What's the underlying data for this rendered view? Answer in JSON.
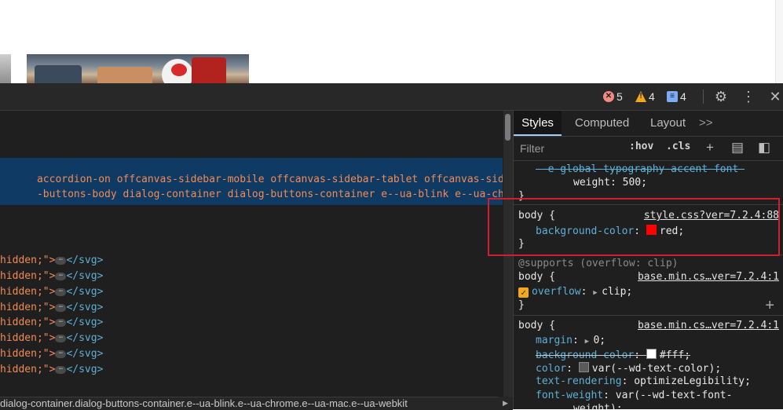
{
  "toolbar": {
    "errors": "5",
    "warnings": "4",
    "messages": "4"
  },
  "elements": {
    "selected_line1": "accordion-on offcanvas-sidebar-mobile offcanvas-sidebar-tablet offcanvas-side",
    "selected_line2": "-buttons-body dialog-container dialog-buttons-container e--ua-blink e--ua-chr",
    "svg_lines": [
      {
        "attr": "hidden;\">",
        "close": "</svg>"
      },
      {
        "attr": "hidden;\">",
        "close": "</svg>"
      },
      {
        "attr": "hidden;\">",
        "close": "</svg>"
      },
      {
        "attr": "hidden;\">",
        "close": "</svg>"
      },
      {
        "attr": "hidden;\">",
        "close": "</svg>"
      },
      {
        "attr": "hidden;\">",
        "close": "</svg>"
      },
      {
        "attr": "hidden;\">",
        "close": "</svg>"
      },
      {
        "attr": "hidden;\">",
        "close": "</svg>"
      }
    ],
    "ellipsis": "⋯",
    "breadcrumb": "dialog-container.dialog-buttons-container.e--ua-blink.e--ua-chrome.e--ua-mac.e--ua-webkit"
  },
  "styles": {
    "tabs": {
      "styles": "Styles",
      "computed": "Computed",
      "layout": "Layout",
      "more": ">>"
    },
    "filter_placeholder": "Filter",
    "hov": ":hov",
    "cls": ".cls",
    "rule0": {
      "prop_line": "--e-global-typography-accent-font-",
      "prop_line2": "weight: 500;",
      "close": "}"
    },
    "rule1": {
      "selector": "body {",
      "source": "style.css?ver=7.2.4:88",
      "prop": "background-color",
      "value": "red;",
      "swatch": "#ff0000",
      "close": "}"
    },
    "rule2": {
      "at": "@supports (overflow: clip)",
      "selector": "body {",
      "source": "base.min.cs…ver=7.2.4:1",
      "prop": "overflow",
      "value": "clip;",
      "close": "}"
    },
    "rule3": {
      "selector": "body {",
      "source": "base.min.cs…ver=7.2.4:1",
      "props": [
        {
          "name": "margin",
          "value": "0;",
          "arrow": true
        },
        {
          "name": "background-color",
          "value": "#fff;",
          "swatch": "#ffffff",
          "strike": true
        },
        {
          "name": "color",
          "value": "var(--wd-text-color);",
          "swatch": "#5a5a5a"
        },
        {
          "name": "text-rendering",
          "value": "optimizeLegibility;"
        },
        {
          "name": "font-weight",
          "value": "var(--wd-text-font-"
        }
      ],
      "wrap": "weight);"
    }
  },
  "colors": {
    "highlight": "#d01f2a",
    "accent": "#a8c7fa"
  }
}
